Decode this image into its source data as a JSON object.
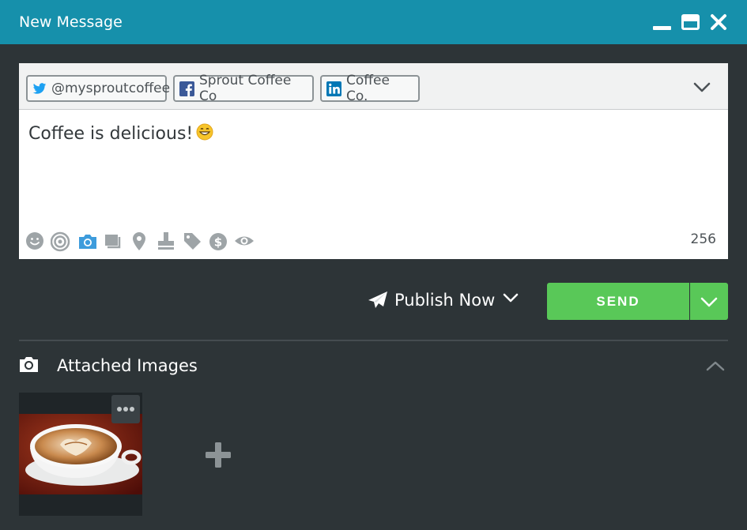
{
  "window": {
    "title": "New Message",
    "controls": [
      "minimize-icon",
      "maximize-icon",
      "close-icon"
    ]
  },
  "composer": {
    "profiles": [
      {
        "network": "twitter",
        "icon": "twitter-icon",
        "label": "@mysproutcoffee"
      },
      {
        "network": "facebook",
        "icon": "facebook-icon",
        "label": "Sprout Coffee Co"
      },
      {
        "network": "linkedin",
        "icon": "linkedin-icon",
        "label": "Coffee Co."
      }
    ],
    "message_text": "Coffee is delicious!",
    "message_emoji": "grinning-face-icon",
    "tools": [
      "emoji-icon",
      "target-icon",
      "camera-icon",
      "gallery-icon",
      "location-icon",
      "stamp-icon",
      "tag-icon",
      "dollar-icon",
      "eye-icon"
    ],
    "char_counter": "256"
  },
  "publish": {
    "mode_label": "Publish Now",
    "send_label": "SEND"
  },
  "attachments": {
    "title": "Attached Images",
    "images": [
      {
        "alt": "latte-art-coffee-cup"
      }
    ]
  },
  "colors": {
    "titlebar": "#1690ab",
    "background": "#2d3437",
    "send_green": "#59c858",
    "twitter": "#1da1f2",
    "facebook": "#3b5998",
    "linkedin": "#0077b5",
    "camera_active": "#3d9cdc"
  }
}
